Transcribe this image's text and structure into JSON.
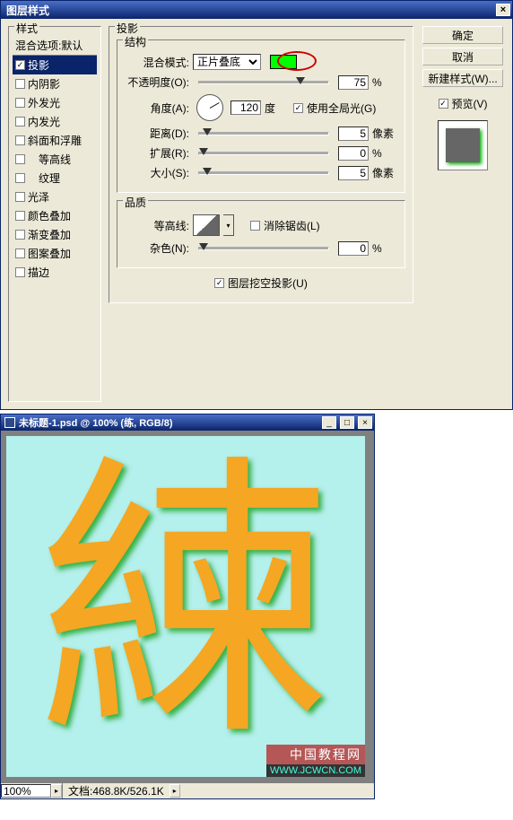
{
  "dialog": {
    "title": "图层样式",
    "styles_legend": "样式",
    "styles": [
      {
        "label": "混合选项:默认",
        "checked": null,
        "header": true
      },
      {
        "label": "投影",
        "checked": true,
        "selected": true
      },
      {
        "label": "内阴影",
        "checked": false
      },
      {
        "label": "外发光",
        "checked": false
      },
      {
        "label": "内发光",
        "checked": false
      },
      {
        "label": "斜面和浮雕",
        "checked": false
      },
      {
        "label": "等高线",
        "checked": false,
        "indent": true
      },
      {
        "label": "纹理",
        "checked": false,
        "indent": true
      },
      {
        "label": "光泽",
        "checked": false
      },
      {
        "label": "颜色叠加",
        "checked": false
      },
      {
        "label": "渐变叠加",
        "checked": false
      },
      {
        "label": "图案叠加",
        "checked": false
      },
      {
        "label": "描边",
        "checked": false
      }
    ],
    "section_title": "投影",
    "structure_legend": "结构",
    "blend_mode_label": "混合模式:",
    "blend_mode_value": "正片叠底",
    "swatch_color": "#00ff00",
    "opacity_label": "不透明度(O):",
    "opacity_value": "75",
    "opacity_unit": "%",
    "angle_label": "角度(A):",
    "angle_value": "120",
    "angle_unit": "度",
    "global_light_label": "使用全局光(G)",
    "global_light_checked": true,
    "distance_label": "距离(D):",
    "distance_value": "5",
    "distance_unit": "像素",
    "spread_label": "扩展(R):",
    "spread_value": "0",
    "spread_unit": "%",
    "size_label": "大小(S):",
    "size_value": "5",
    "size_unit": "像素",
    "quality_legend": "品质",
    "contour_label": "等高线:",
    "antialias_label": "消除锯齿(L)",
    "antialias_checked": false,
    "noise_label": "杂色(N):",
    "noise_value": "0",
    "noise_unit": "%",
    "knockout_label": "图层挖空投影(U)",
    "knockout_checked": true,
    "ok_label": "确定",
    "cancel_label": "取消",
    "new_style_label": "新建样式(W)...",
    "preview_label": "预览(V)",
    "preview_checked": true
  },
  "ps": {
    "title": "未标题-1.psd @ 100% (练, RGB/8)",
    "glyph": "練",
    "zoom": "100%",
    "doc_label": "文档:",
    "doc_info": "468.8K/526.1K"
  },
  "watermark": {
    "line1": "中国教程网",
    "line2": "WWW.JCWCN.COM"
  },
  "chart_data": {
    "type": "table",
    "title": "Drop Shadow settings",
    "rows": [
      {
        "param": "混合模式",
        "value": "正片叠底"
      },
      {
        "param": "颜色",
        "value": "#00ff00"
      },
      {
        "param": "不透明度",
        "value": 75,
        "unit": "%"
      },
      {
        "param": "角度",
        "value": 120,
        "unit": "度"
      },
      {
        "param": "使用全局光",
        "value": true
      },
      {
        "param": "距离",
        "value": 5,
        "unit": "像素"
      },
      {
        "param": "扩展",
        "value": 0,
        "unit": "%"
      },
      {
        "param": "大小",
        "value": 5,
        "unit": "像素"
      },
      {
        "param": "消除锯齿",
        "value": false
      },
      {
        "param": "杂色",
        "value": 0,
        "unit": "%"
      },
      {
        "param": "图层挖空投影",
        "value": true
      }
    ]
  }
}
